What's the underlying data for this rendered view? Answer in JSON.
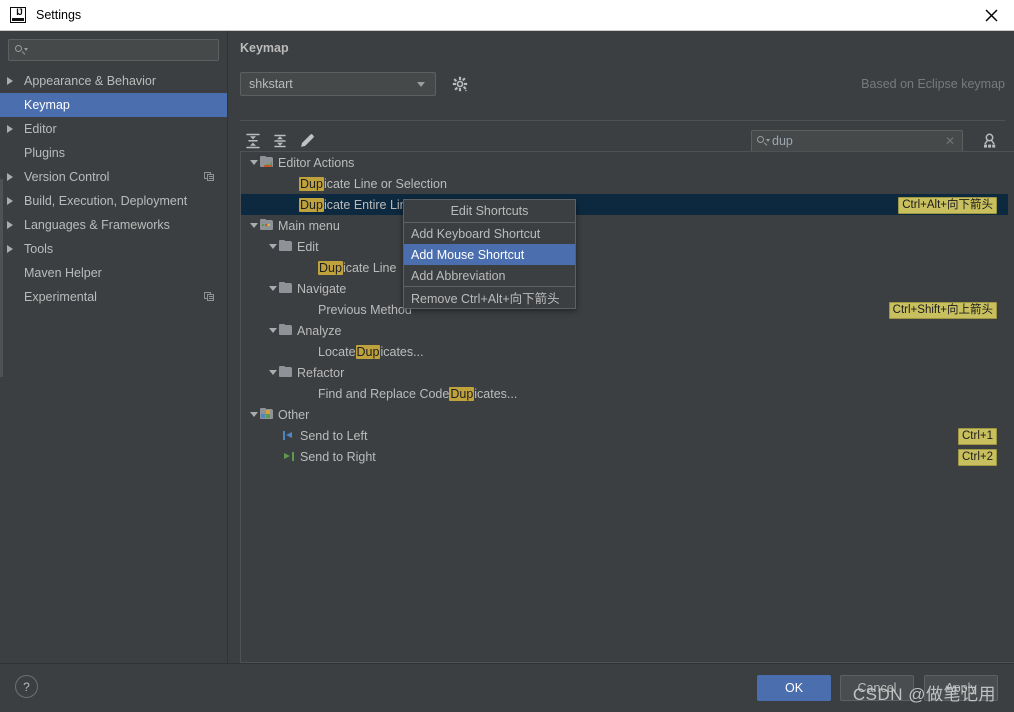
{
  "window": {
    "title": "Settings",
    "app_icon": "intellij-idea-icon",
    "close_icon": "close-icon"
  },
  "sidebar": {
    "search": {
      "placeholder": "",
      "value": "",
      "icon": "search-icon"
    },
    "items": [
      {
        "label": "Appearance & Behavior",
        "expandable": true,
        "selected": false,
        "side_icon": false
      },
      {
        "label": "Keymap",
        "expandable": false,
        "selected": true,
        "side_icon": false
      },
      {
        "label": "Editor",
        "expandable": true,
        "selected": false,
        "side_icon": false
      },
      {
        "label": "Plugins",
        "expandable": false,
        "selected": false,
        "side_icon": false
      },
      {
        "label": "Version Control",
        "expandable": true,
        "selected": false,
        "side_icon": true
      },
      {
        "label": "Build, Execution, Deployment",
        "expandable": true,
        "selected": false,
        "side_icon": false
      },
      {
        "label": "Languages & Frameworks",
        "expandable": true,
        "selected": false,
        "side_icon": false
      },
      {
        "label": "Tools",
        "expandable": true,
        "selected": false,
        "side_icon": false
      },
      {
        "label": "Maven Helper",
        "expandable": false,
        "selected": false,
        "side_icon": false
      },
      {
        "label": "Experimental",
        "expandable": false,
        "selected": false,
        "side_icon": true
      }
    ]
  },
  "panel": {
    "title": "Keymap",
    "keymap_select": {
      "value": "shkstart",
      "caret_icon": "chevron-down-icon"
    },
    "gear_icon": "gear-icon",
    "based_on": "Based on Eclipse keymap",
    "toolbar": {
      "expand_all_icon": "expand-all-icon",
      "collapse_all_icon": "collapse-all-icon",
      "edit_icon": "pencil-edit-icon",
      "find_icon": "find-action-icon"
    },
    "filter": {
      "value": "dup",
      "search_icon": "search-icon",
      "clear_icon": "clear-x-icon"
    }
  },
  "tree": {
    "highlight_term": "Dup",
    "rows": [
      {
        "id": "editor-actions",
        "indent": 0,
        "arrow": "down",
        "icon": "editor-actions-folder-icon",
        "label": "Editor Actions",
        "pre": "",
        "post": "",
        "shortcut": "",
        "selected": false
      },
      {
        "id": "dup-line-or-sel",
        "indent": 2,
        "arrow": "none",
        "icon": "none",
        "label": "",
        "pre": "",
        "post": "icate Line or Selection",
        "shortcut": "",
        "selected": false
      },
      {
        "id": "dup-entire-lines",
        "indent": 2,
        "arrow": "none",
        "icon": "none",
        "label": "",
        "pre": "",
        "post": "icate Entire Lines",
        "shortcut": "Ctrl+Alt+向下箭头",
        "selected": true
      },
      {
        "id": "main-menu",
        "indent": 0,
        "arrow": "down",
        "icon": "main-menu-folder-icon",
        "label": "Main menu",
        "pre": "",
        "post": "",
        "shortcut": "",
        "selected": false
      },
      {
        "id": "edit",
        "indent": 1,
        "arrow": "down",
        "icon": "folder-icon",
        "label": "Edit",
        "pre": "",
        "post": "",
        "shortcut": "",
        "selected": false
      },
      {
        "id": "dup-line",
        "indent": 3,
        "arrow": "none",
        "icon": "none",
        "label": "",
        "pre": "",
        "post": "icate Line ",
        "shortcut": "",
        "selected": false
      },
      {
        "id": "navigate",
        "indent": 1,
        "arrow": "down",
        "icon": "folder-icon",
        "label": "Navigate",
        "pre": "",
        "post": "",
        "shortcut": "",
        "selected": false
      },
      {
        "id": "previous-method",
        "indent": 3,
        "arrow": "none",
        "icon": "none",
        "label": "Previous Method",
        "pre": "",
        "post": "",
        "shortcut": "Ctrl+Shift+向上箭头",
        "selected": false
      },
      {
        "id": "analyze",
        "indent": 1,
        "arrow": "down",
        "icon": "folder-icon",
        "label": "Analyze",
        "pre": "",
        "post": "",
        "shortcut": "",
        "selected": false
      },
      {
        "id": "locate-dup",
        "indent": 3,
        "arrow": "none",
        "icon": "none",
        "label": "",
        "pre": "Locate ",
        "post": "icates...",
        "shortcut": "",
        "selected": false
      },
      {
        "id": "refactor",
        "indent": 1,
        "arrow": "down",
        "icon": "folder-icon",
        "label": "Refactor",
        "pre": "",
        "post": "",
        "shortcut": "",
        "selected": false
      },
      {
        "id": "find-replace-dup",
        "indent": 3,
        "arrow": "none",
        "icon": "none",
        "label": "",
        "pre": "Find and Replace Code ",
        "post": "icates...",
        "shortcut": "",
        "selected": false
      },
      {
        "id": "other",
        "indent": 0,
        "arrow": "down",
        "icon": "other-folder-icon",
        "label": "Other",
        "pre": "",
        "post": "",
        "shortcut": "",
        "selected": false
      },
      {
        "id": "send-to-left",
        "indent": 1,
        "arrow": "none",
        "icon": "send-to-left-icon",
        "label": "Send to Left",
        "pre": "",
        "post": "",
        "shortcut": "Ctrl+1",
        "selected": false
      },
      {
        "id": "send-to-right",
        "indent": 1,
        "arrow": "none",
        "icon": "send-to-right-icon",
        "label": "Send to Right",
        "pre": "",
        "post": "",
        "shortcut": "Ctrl+2",
        "selected": false
      }
    ]
  },
  "context_menu": {
    "header": "Edit Shortcuts",
    "items": [
      {
        "label": "Add Keyboard Shortcut",
        "active": false
      },
      {
        "label": "Add Mouse Shortcut",
        "active": true
      },
      {
        "label": "Add Abbreviation",
        "active": false
      },
      {
        "label": "Remove Ctrl+Alt+向下箭头",
        "active": false
      }
    ]
  },
  "footer": {
    "help_label": "?",
    "ok": "OK",
    "cancel": "Cancel",
    "apply": "Apply",
    "watermark": "CSDN @做笔记用"
  },
  "colors": {
    "selection_blue": "#4b6eaf",
    "row_selected": "#0d293f",
    "highlight_yellow": "#c0a23c",
    "shortcut_badge": "#c8bf5f",
    "panel_bg": "#3c3f41"
  }
}
